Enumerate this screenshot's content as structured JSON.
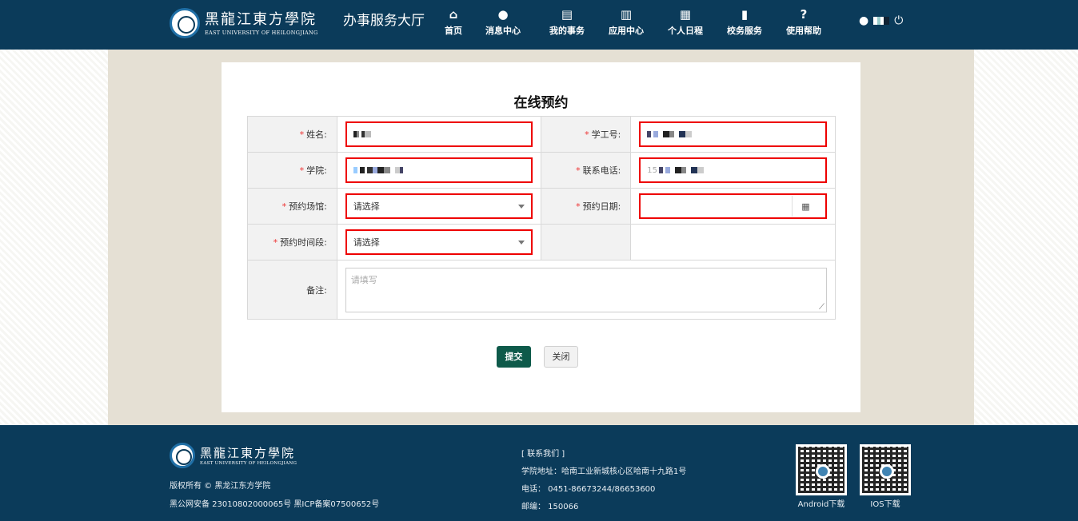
{
  "header": {
    "logo_cn": "黑龍江東方學院",
    "logo_en": "EAST UNIVERSITY OF HEILONGJIANG",
    "hall_title": "办事服务大厅",
    "nav": [
      {
        "label": "首页",
        "icon": "home-icon",
        "glyph": "⌂"
      },
      {
        "label": "消息中心",
        "icon": "chat-icon",
        "glyph": "●"
      },
      {
        "label": "我的事务",
        "icon": "list-icon",
        "glyph": "▤"
      },
      {
        "label": "应用中心",
        "icon": "books-icon",
        "glyph": "▥"
      },
      {
        "label": "个人日程",
        "icon": "calendar-icon",
        "glyph": "▦"
      },
      {
        "label": "校务服务",
        "icon": "bar-chart-icon",
        "glyph": "▮"
      },
      {
        "label": "使用帮助",
        "icon": "help-icon",
        "glyph": "?"
      }
    ],
    "user_icon": "user-icon",
    "power_icon": "power-icon"
  },
  "form": {
    "title": "在线预约",
    "required_mark": "*",
    "labels": {
      "name": "姓名:",
      "student_id": "学工号:",
      "college": "学院:",
      "phone": "联系电话:",
      "venue": "预约场馆:",
      "date": "预约日期:",
      "time_slot": "预约时间段:",
      "remark": "备注:"
    },
    "venue_value": "请选择",
    "time_slot_value": "请选择",
    "phone_value": "15",
    "remark_placeholder": "请填写",
    "submit_label": "提交",
    "close_label": "关闭"
  },
  "footer": {
    "logo_cn": "黑龍江東方學院",
    "logo_en": "EAST UNIVERSITY OF HEILONGJIANG",
    "copyright": "版权所有 © 黑龙江东方学院",
    "icp": "黑公网安备 23010802000065号 黑ICP备案07500652号",
    "contact_title": "[ 联系我们 ]",
    "address": "学院地址：哈南工业新城核心区哈南十九路1号",
    "phone": "电话： 0451-86673244/86653600",
    "zip": "邮编： 150066",
    "android_label": "Android下载",
    "ios_label": "IOS下载"
  }
}
